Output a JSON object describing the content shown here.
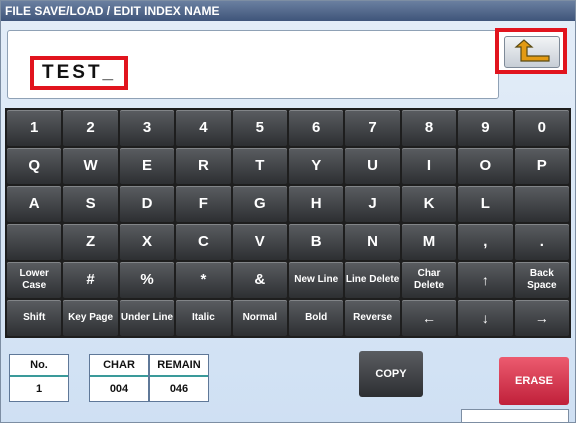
{
  "title": "FILE SAVE/LOAD / EDIT INDEX NAME",
  "entry": {
    "text": "TEST_"
  },
  "back_button": {
    "icon": "return-arrow-icon"
  },
  "keyboard": {
    "rows": [
      [
        "1",
        "2",
        "3",
        "4",
        "5",
        "6",
        "7",
        "8",
        "9",
        "0"
      ],
      [
        "Q",
        "W",
        "E",
        "R",
        "T",
        "Y",
        "U",
        "I",
        "O",
        "P"
      ],
      [
        "A",
        "S",
        "D",
        "F",
        "G",
        "H",
        "J",
        "K",
        "L",
        ""
      ],
      [
        "",
        "Z",
        "X",
        "C",
        "V",
        "B",
        "N",
        "M",
        ",",
        "."
      ],
      [
        "Lower Case",
        "#",
        "%",
        "*",
        "&",
        "New Line",
        "Line Delete",
        "Char Delete",
        "↑",
        "Back Space"
      ],
      [
        "Shift",
        "Key Page",
        "Under Line",
        "Italic",
        "Normal",
        "Bold",
        "Reverse",
        "←",
        "↓",
        "→"
      ]
    ]
  },
  "counters": [
    {
      "label": "No.",
      "value": "1"
    },
    {
      "label": "CHAR",
      "value": "004"
    },
    {
      "label": "REMAIN",
      "value": "046"
    }
  ],
  "copy_label": "COPY",
  "erase_label": "ERASE",
  "colors": {
    "title_bar": "#3f557a",
    "highlight_red": "#e1141e",
    "key": "#3a3d41",
    "erase": "#d6304a"
  }
}
